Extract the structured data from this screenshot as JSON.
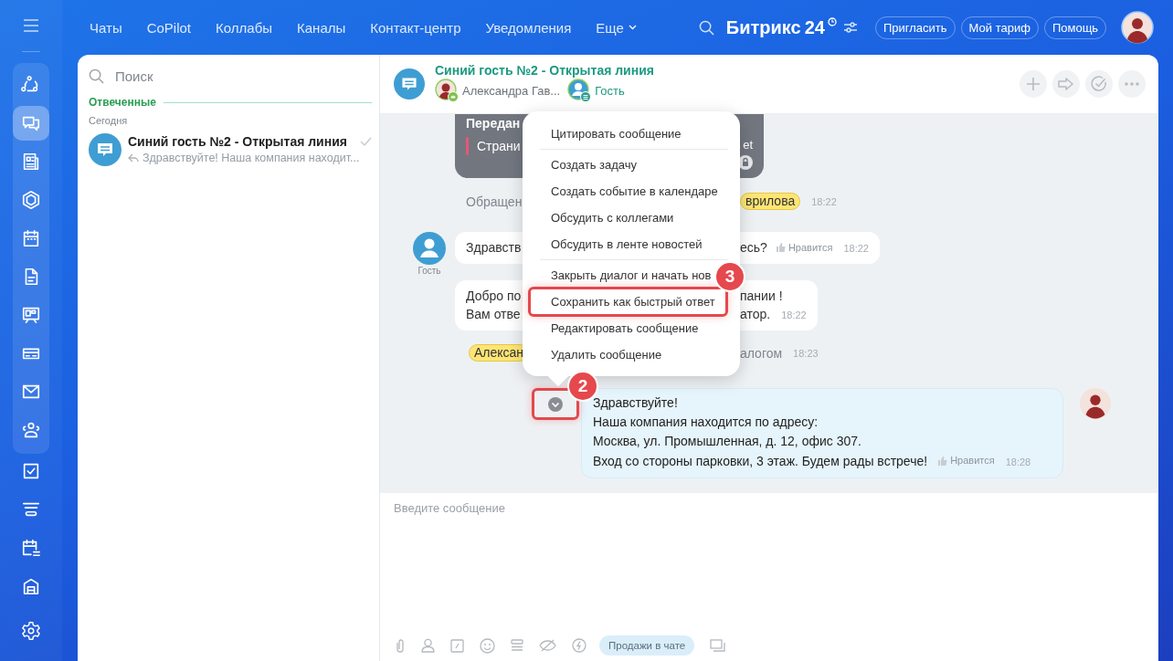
{
  "rail_items": [
    {
      "selected": false
    },
    {
      "selected": true
    },
    {
      "selected": false
    },
    {
      "selected": false
    },
    {
      "selected": false
    },
    {
      "selected": false
    },
    {
      "selected": false
    },
    {
      "selected": false
    },
    {
      "selected": false
    },
    {
      "selected": false
    },
    {
      "selected": false
    },
    {
      "selected": false
    },
    {
      "selected": false
    },
    {
      "selected": false
    }
  ],
  "nav": [
    "Чаты",
    "CoPilot",
    "Коллабы",
    "Каналы",
    "Контакт-центр",
    "Уведомления",
    "Еще"
  ],
  "logo": {
    "name": "Битрикс",
    "number": "24"
  },
  "top_buttons": [
    "Пригласить",
    "Мой тариф",
    "Помощь"
  ],
  "search": {
    "placeholder": "Поиск"
  },
  "recent": {
    "section": "Отвеченные",
    "day": "Сегодня",
    "chats": [
      {
        "title": "Синий гость №2 - Открытая линия",
        "preview": "Здравствуйте! Наша компания находит...",
        "read": true,
        "selected": false
      }
    ]
  },
  "chat": {
    "title": "Синий гость №2 - Открытая линия",
    "members": [
      {
        "name": "Александра Гав...",
        "kind": "operator"
      },
      {
        "name": "Гость",
        "kind": "guest"
      }
    ]
  },
  "messages": [
    {
      "kind": "forwarded",
      "left": [
        "Передан",
        "Страни"
      ],
      "right": "et"
    },
    {
      "kind": "system",
      "left": "Обращен",
      "tag": "врилова",
      "time": "18:22"
    },
    {
      "kind": "incoming",
      "author": "Гость",
      "left": [
        "Здравств"
      ],
      "right": [
        "есь?"
      ],
      "like": "Нравится",
      "time": "18:22"
    },
    {
      "kind": "incoming",
      "left": [
        "Добро по",
        "Вам отве"
      ],
      "right": [
        "пании !",
        "атор."
      ],
      "time": "18:22"
    },
    {
      "kind": "system",
      "left_tag": "Алексан",
      "right": "алогом",
      "time": "18:23"
    },
    {
      "kind": "outgoing",
      "lines": [
        "Здравствуйте!",
        "Наша компания находится по адресу:",
        "Москва, ул. Промышленная, д. 12, офис 307.",
        "Вход со стороны парковки, 3 этаж. Будем рады встрече!"
      ],
      "like": "Нравится",
      "time": "18:28",
      "button_marked": true,
      "badge": "2"
    }
  ],
  "context_menu": {
    "badge": "3",
    "items": [
      {
        "label": "Цитировать сообщение",
        "divider_after": true,
        "marked": false
      },
      {
        "label": "Создать задачу",
        "divider_after": false,
        "marked": false
      },
      {
        "label": "Создать событие в календаре",
        "divider_after": false,
        "marked": false
      },
      {
        "label": "Обсудить с коллегами",
        "divider_after": false,
        "marked": false
      },
      {
        "label": "Обсудить в ленте новостей",
        "divider_after": true,
        "marked": false
      },
      {
        "label": "Закрыть диалог и начать нов",
        "divider_after": false,
        "marked": false
      },
      {
        "label": "Сохранить как быстрый ответ",
        "divider_after": false,
        "marked": true
      },
      {
        "label": "Редактировать сообщение",
        "divider_after": false,
        "marked": false
      },
      {
        "label": "Удалить сообщение",
        "divider_after": false,
        "marked": false
      }
    ]
  },
  "composer": {
    "placeholder": "Введите сообщение",
    "sales_button": "Продажи в чате"
  }
}
